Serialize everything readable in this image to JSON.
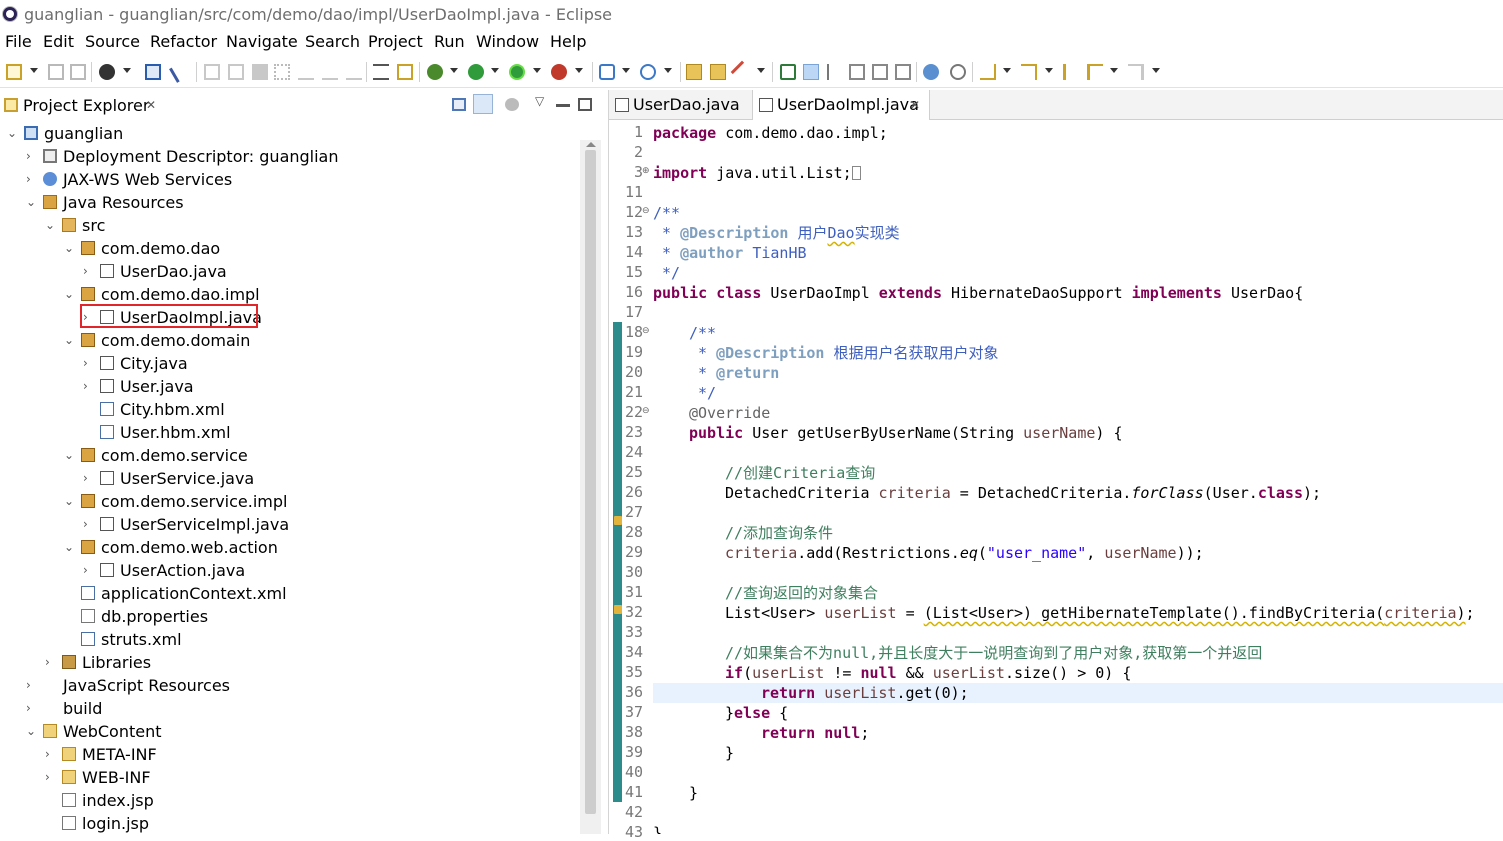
{
  "window": {
    "title": "guanglian - guanglian/src/com/demo/dao/impl/UserDaoImpl.java - Eclipse"
  },
  "menu": [
    "File",
    "Edit",
    "Source",
    "Refactor",
    "Navigate",
    "Search",
    "Project",
    "Run",
    "Window",
    "Help"
  ],
  "explorer": {
    "title": "Project Explorer",
    "tree": [
      {
        "label": "guanglian",
        "icon": "project-icon",
        "expanded": true
      },
      {
        "label": "Deployment Descriptor: guanglian",
        "icon": "deployment-descriptor-icon",
        "expanded": false
      },
      {
        "label": "JAX-WS Web Services",
        "icon": "web-services-icon",
        "expanded": false
      },
      {
        "label": "Java Resources",
        "icon": "java-resources-icon",
        "expanded": true
      },
      {
        "label": "src",
        "icon": "source-folder-icon",
        "expanded": true
      },
      {
        "label": "com.demo.dao",
        "icon": "package-icon",
        "expanded": true
      },
      {
        "label": "UserDao.java",
        "icon": "java-interface-file-icon",
        "expanded": false
      },
      {
        "label": "com.demo.dao.impl",
        "icon": "package-icon",
        "expanded": true
      },
      {
        "label": "UserDaoImpl.java",
        "icon": "java-file-icon",
        "expanded": false,
        "highlighted": true
      },
      {
        "label": "com.demo.domain",
        "icon": "package-icon",
        "expanded": true
      },
      {
        "label": "City.java",
        "icon": "java-file-icon",
        "expanded": false
      },
      {
        "label": "User.java",
        "icon": "java-file-icon",
        "expanded": false
      },
      {
        "label": "City.hbm.xml",
        "icon": "xml-file-icon"
      },
      {
        "label": "User.hbm.xml",
        "icon": "xml-file-icon"
      },
      {
        "label": "com.demo.service",
        "icon": "package-icon",
        "expanded": true
      },
      {
        "label": "UserService.java",
        "icon": "java-interface-file-icon",
        "expanded": false
      },
      {
        "label": "com.demo.service.impl",
        "icon": "package-icon",
        "expanded": true
      },
      {
        "label": "UserServiceImpl.java",
        "icon": "java-file-icon",
        "expanded": false
      },
      {
        "label": "com.demo.web.action",
        "icon": "package-icon",
        "expanded": true
      },
      {
        "label": "UserAction.java",
        "icon": "java-file-icon",
        "expanded": false
      },
      {
        "label": "applicationContext.xml",
        "icon": "xml-file-icon"
      },
      {
        "label": "db.properties",
        "icon": "properties-file-icon"
      },
      {
        "label": "struts.xml",
        "icon": "xml-file-icon"
      },
      {
        "label": "Libraries",
        "icon": "libraries-icon",
        "expanded": false
      },
      {
        "label": "JavaScript Resources",
        "icon": "javascript-resources-icon",
        "expanded": false
      },
      {
        "label": "build",
        "icon": "folder-icon",
        "expanded": false
      },
      {
        "label": "WebContent",
        "icon": "folder-icon",
        "expanded": true
      },
      {
        "label": "META-INF",
        "icon": "folder-icon",
        "expanded": false
      },
      {
        "label": "WEB-INF",
        "icon": "folder-icon",
        "expanded": false
      },
      {
        "label": "index.jsp",
        "icon": "jsp-file-icon"
      },
      {
        "label": "login.jsp",
        "icon": "jsp-file-icon"
      }
    ]
  },
  "editor": {
    "tabs": [
      {
        "label": "UserDao.java",
        "active": false
      },
      {
        "label": "UserDaoImpl.java",
        "active": true
      }
    ],
    "line_numbers": [
      "1",
      "2",
      "3",
      "11",
      "12",
      "13",
      "14",
      "15",
      "16",
      "17",
      "18",
      "19",
      "20",
      "21",
      "22",
      "23",
      "24",
      "25",
      "26",
      "27",
      "28",
      "29",
      "30",
      "31",
      "32",
      "33",
      "34",
      "35",
      "36",
      "37",
      "38",
      "39",
      "40",
      "41",
      "42",
      "43"
    ],
    "code": {
      "l1_kw": "package",
      "l1_rest": " com.demo.dao.impl;",
      "l3_kw": "import",
      "l3_rest": " java.util.List;",
      "l12": "/**",
      "l13_a": " * ",
      "l13_tag": "@Description",
      "l13_b": " 用户",
      "l13_c": "Dao",
      "l13_d": "实现类",
      "l14_a": " * ",
      "l14_tag": "@author",
      "l14_b": " TianHB",
      "l15": " */",
      "l16_k1": "public class",
      "l16_t1": " UserDaoImpl ",
      "l16_k2": "extends",
      "l16_t2": " HibernateDaoSupport ",
      "l16_k3": "implements",
      "l16_t3": " UserDao{",
      "l18": "/**",
      "l19_a": " * ",
      "l19_tag": "@Description",
      "l19_b": " 根据用户名获取用户对象",
      "l20_a": " * ",
      "l20_tag": "@return",
      "l21": " */",
      "l22": "@Override",
      "l23_k": "public",
      "l23_t1": " User getUserByUserName(String ",
      "l23_v": "userName",
      "l23_t2": ") {",
      "l25": "//创建Criteria查询",
      "l26_t1": "DetachedCriteria ",
      "l26_v": "criteria",
      "l26_t2": " = DetachedCriteria.",
      "l26_m": "forClass",
      "l26_t3": "(User.",
      "l26_k": "class",
      "l26_t4": ");",
      "l28": "//添加查询条件",
      "l29_v1": "criteria",
      "l29_t1": ".add(Restrictions.",
      "l29_m": "eq",
      "l29_t2": "(",
      "l29_s": "\"user_name\"",
      "l29_t3": ", ",
      "l29_v2": "userName",
      "l29_t4": "));",
      "l31": "//查询返回的对象集合",
      "l32_t1": "List<User> ",
      "l32_v1": "userList",
      "l32_t2": " = ",
      "l32_sq": "(List<User>) getHibernateTemplate().findByCriteria(",
      "l32_v2": "criteria",
      "l32_sq2": ")",
      "l32_t3": ";",
      "l34": "//如果集合不为null,并且长度大于一说明查询到了用户对象,获取第一个并返回",
      "l35_k1": "if",
      "l35_t1": "(",
      "l35_v1": "userList",
      "l35_t2": " != ",
      "l35_k2": "null",
      "l35_t3": " && ",
      "l35_v2": "userList",
      "l35_t4": ".size() > 0) {",
      "l36_k": "return",
      "l36_t1": " ",
      "l36_v": "userList",
      "l36_t2": ".get(0);",
      "l37_t": "}",
      "l37_k": "else",
      "l37_t2": " {",
      "l38_k1": "return",
      "l38_t": " ",
      "l38_k2": "null",
      "l38_t2": ";",
      "l39": "}",
      "l41": "}",
      "l43": "}"
    }
  },
  "colors": {
    "keyword": "#7f0055",
    "javadoc": "#3f5fbf",
    "javadoc_tag": "#7f9fbf",
    "line_comment": "#3f7f5f",
    "string": "#2a00ff",
    "local_variable": "#6a3e3e",
    "selection_outline": "#e0262b",
    "change_bar": "#2e8b8b"
  }
}
